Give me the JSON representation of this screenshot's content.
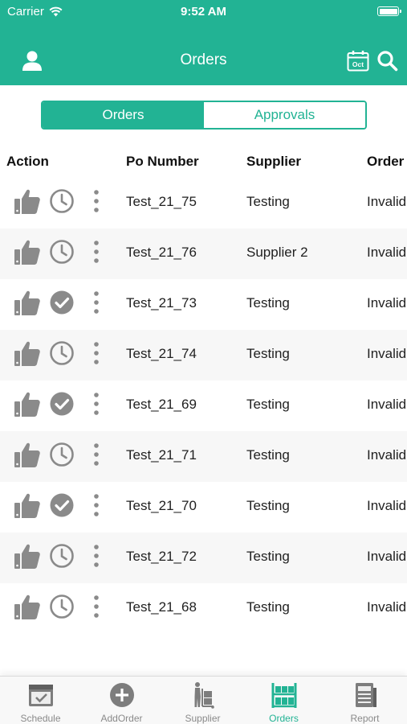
{
  "status_bar": {
    "carrier": "Carrier",
    "time": "9:52 AM"
  },
  "header": {
    "title": "Orders",
    "calendar_month": "Oct"
  },
  "segmented": {
    "tabs": [
      {
        "label": "Orders",
        "active": true
      },
      {
        "label": "Approvals",
        "active": false
      }
    ]
  },
  "columns": {
    "action": "Action",
    "po_number": "Po Number",
    "supplier": "Supplier",
    "order": "Order"
  },
  "rows": [
    {
      "po_number": "Test_21_75",
      "supplier": "Testing",
      "order": "Invalid",
      "status_icon": "clock-icon"
    },
    {
      "po_number": "Test_21_76",
      "supplier": "Supplier 2",
      "order": "Invalid",
      "status_icon": "clock-icon"
    },
    {
      "po_number": "Test_21_73",
      "supplier": "Testing",
      "order": "Invalid",
      "status_icon": "check-circle-icon"
    },
    {
      "po_number": "Test_21_74",
      "supplier": "Testing",
      "order": "Invalid",
      "status_icon": "clock-icon"
    },
    {
      "po_number": "Test_21_69",
      "supplier": "Testing",
      "order": "Invalid",
      "status_icon": "check-circle-icon"
    },
    {
      "po_number": "Test_21_71",
      "supplier": "Testing",
      "order": "Invalid",
      "status_icon": "clock-icon"
    },
    {
      "po_number": "Test_21_70",
      "supplier": "Testing",
      "order": "Invalid",
      "status_icon": "check-circle-icon"
    },
    {
      "po_number": "Test_21_72",
      "supplier": "Testing",
      "order": "Invalid",
      "status_icon": "clock-icon"
    },
    {
      "po_number": "Test_21_68",
      "supplier": "Testing",
      "order": "Invalid",
      "status_icon": "clock-icon"
    }
  ],
  "tabbar": {
    "items": [
      {
        "label": "Schedule",
        "icon": "schedule-icon",
        "active": false
      },
      {
        "label": "AddOrder",
        "icon": "add-circle-icon",
        "active": false
      },
      {
        "label": "Supplier",
        "icon": "supplier-dolly-icon",
        "active": false
      },
      {
        "label": "Orders",
        "icon": "orders-warehouse-icon",
        "active": true
      },
      {
        "label": "Report",
        "icon": "report-icon",
        "active": false
      }
    ]
  },
  "colors": {
    "accent": "#22b394",
    "icon_gray": "#8a8a8a",
    "tab_inactive": "#8a8a8a"
  }
}
